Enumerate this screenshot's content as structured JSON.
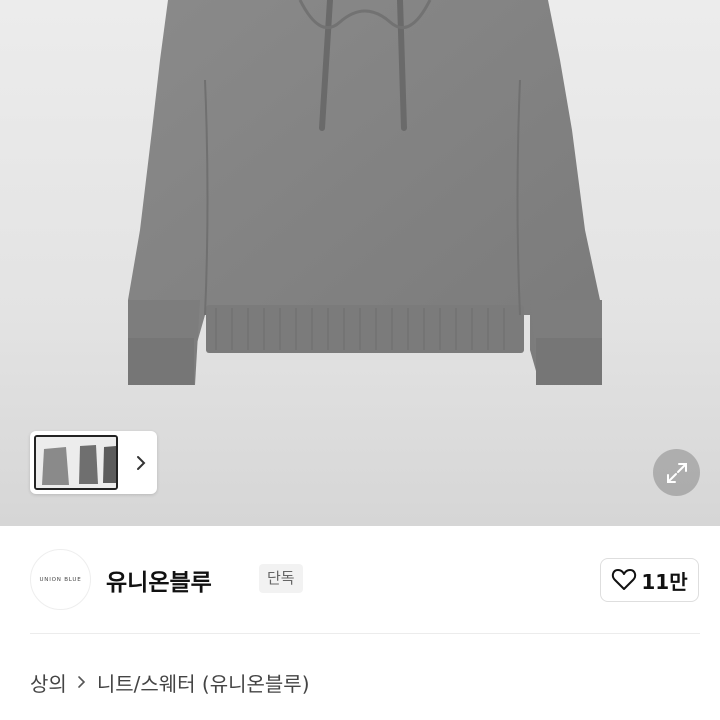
{
  "product": {
    "image_icon": "product-photo",
    "thumbnails_icon": "product-thumbnail-set",
    "next_icon": "chevron-right-icon",
    "expand_icon": "expand-arrows-icon"
  },
  "seller": {
    "logo_text": "UNION BLUE",
    "name": "유니온블루",
    "badge": "단독",
    "likes": "11만",
    "like_icon": "heart-outline-icon"
  },
  "breadcrumb": {
    "items": [
      "상의",
      "니트/스웨터 (유니온블루)"
    ],
    "separator_icon": "chevron-right-icon"
  },
  "colors": {
    "sweater": "#808080",
    "background": "#e6e6e6",
    "accent": "#111111"
  }
}
